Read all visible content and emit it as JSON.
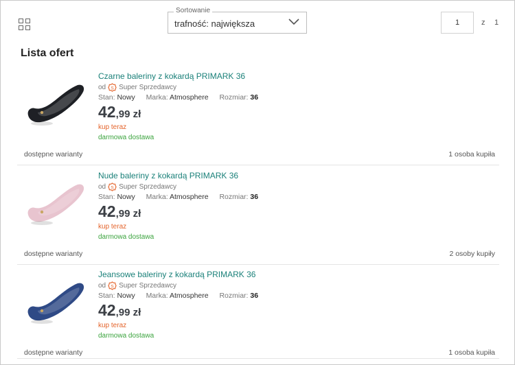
{
  "toolbar": {
    "grid_icon": "grid-view-icon",
    "sort_legend": "Sortowanie",
    "sort_value": "trafność: największa",
    "page_current": "1",
    "page_of": "z",
    "page_total": "1"
  },
  "list": {
    "title": "Lista ofert"
  },
  "colors": {
    "link": "#1a8079",
    "buy_now": "#e4632a",
    "free_shipping": "#3aa33d",
    "price": "#3b3f45"
  },
  "offers": [
    {
      "title": "Czarne baleriny z kokardą PRIMARK 36",
      "seller_prefix": "od",
      "seller": "Super Sprzedawcy",
      "condition_label": "Stan:",
      "condition": "Nowy",
      "brand_label": "Marka:",
      "brand": "Atmosphere",
      "size_label": "Rozmiar:",
      "size": "36",
      "price_int": "42",
      "price_rest": ",99 zł",
      "buy_now": "kup teraz",
      "shipping": "darmowa dostawa",
      "variants": "dostępne warianty",
      "buyers": "1 osoba kupiła",
      "shoe_color": "#1e2025"
    },
    {
      "title": "Nude baleriny z kokardą PRIMARK 36",
      "seller_prefix": "od",
      "seller": "Super Sprzedawcy",
      "condition_label": "Stan:",
      "condition": "Nowy",
      "brand_label": "Marka:",
      "brand": "Atmosphere",
      "size_label": "Rozmiar:",
      "size": "36",
      "price_int": "42",
      "price_rest": ",99 zł",
      "buy_now": "kup teraz",
      "shipping": "darmowa dostawa",
      "variants": "dostępne warianty",
      "buyers": "2 osoby kupiły",
      "shoe_color": "#e8c4cf"
    },
    {
      "title": "Jeansowe baleriny z kokardą PRIMARK 36",
      "seller_prefix": "od",
      "seller": "Super Sprzedawcy",
      "condition_label": "Stan:",
      "condition": "Nowy",
      "brand_label": "Marka:",
      "brand": "Atmosphere",
      "size_label": "Rozmiar:",
      "size": "36",
      "price_int": "42",
      "price_rest": ",99 zł",
      "buy_now": "kup teraz",
      "shipping": "darmowa dostawa",
      "variants": "dostępne warianty",
      "buyers": "1 osoba kupiła",
      "shoe_color": "#2f4a86"
    }
  ]
}
